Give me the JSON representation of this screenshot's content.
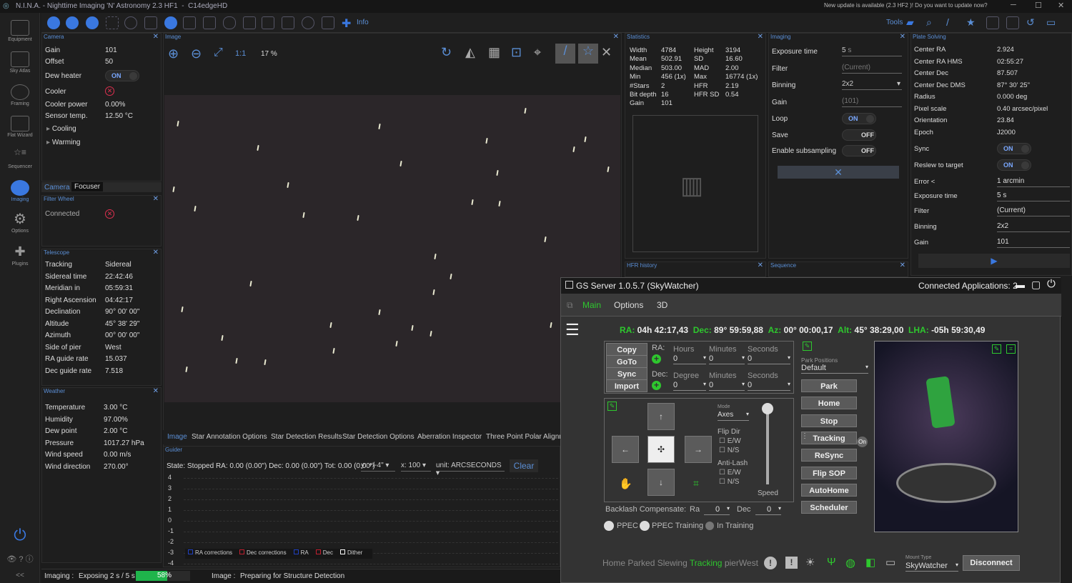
{
  "app": {
    "title": "N.I.N.A. - Nighttime Imaging 'N' Astronomy 2.3 HF1",
    "profile": "C14edgeHD",
    "update": "New update is available (2.3 HF2 )! Do you want to update now?"
  },
  "sidebar": [
    {
      "label": "Equipment"
    },
    {
      "label": "Sky Atlas"
    },
    {
      "label": "Framing"
    },
    {
      "label": "Flat Wizard"
    },
    {
      "label": "Sequencer"
    },
    {
      "label": "Imaging"
    },
    {
      "label": "Options"
    },
    {
      "label": "Plugins"
    }
  ],
  "toolbar": {
    "info": "Info",
    "tools": "Tools"
  },
  "camera": {
    "title": "Camera",
    "rows": [
      [
        "Gain",
        "101"
      ],
      [
        "Offset",
        "50"
      ],
      [
        "Dew heater",
        "ON"
      ],
      [
        "Cooler",
        ""
      ],
      [
        "Cooler power",
        "0.00%"
      ],
      [
        "Sensor temp.",
        "12.50 °C"
      ]
    ],
    "cooling": "Cooling",
    "warming": "Warming"
  },
  "tabs_cf": {
    "camera": "Camera",
    "focuser": "Focuser"
  },
  "filterwheel": {
    "title": "Filter Wheel",
    "connected": "Connected"
  },
  "telescope": {
    "title": "Telescope",
    "rows": [
      [
        "Tracking",
        "Sidereal"
      ],
      [
        "Sidereal time",
        "22:42:46"
      ],
      [
        "Meridian in",
        "05:59:31"
      ],
      [
        "Right Ascension",
        "04:42:17"
      ],
      [
        "Declination",
        "90° 00' 00\""
      ],
      [
        "Altitude",
        "45° 38' 29\""
      ],
      [
        "Azimuth",
        "00° 00' 00\""
      ],
      [
        "Side of pier",
        "West"
      ],
      [
        "RA guide rate",
        "15.037"
      ],
      [
        "Dec guide rate",
        "7.518"
      ]
    ]
  },
  "weather": {
    "title": "Weather",
    "rows": [
      [
        "Temperature",
        "3.00 °C"
      ],
      [
        "Humidity",
        "97.00%"
      ],
      [
        "Dew point",
        "2.00 °C"
      ],
      [
        "Pressure",
        "1017.27 hPa"
      ],
      [
        "Wind speed",
        "0.00 m/s"
      ],
      [
        "Wind direction",
        "270.00°"
      ]
    ]
  },
  "image": {
    "title": "Image",
    "zoom": "17 %",
    "ratio": "1:1"
  },
  "imagetabs": [
    "Image",
    "Star Annotation Options",
    "Star Detection Results",
    "Star Detection Options",
    "Aberration Inspector",
    "Three Point Polar Alignm"
  ],
  "guider": {
    "title": "Guider",
    "state": "State: Stopped  RA: 0.00 (0.00\")  Dec: 0.00 (0.00\")  Tot: 0.00 (0.00\")",
    "y": "y: +/-4\"",
    "x": "x: 100",
    "unit": "unit: ARCSECONDS",
    "clear": "Clear",
    "yticks": [
      "4",
      "3",
      "2",
      "1",
      "0",
      "-1",
      "-2",
      "-3",
      "-4"
    ],
    "legend": [
      "RA corrections",
      "Dec corrections",
      "RA",
      "Dec",
      "Dither"
    ]
  },
  "status": {
    "imaging_label": "Imaging :",
    "imaging": "Exposing 2 s / 5 s",
    "progress": "58%",
    "progress_val": 0.58,
    "image_label": "Image :",
    "image": "Preparing for Structure Detection"
  },
  "statistics": {
    "title": "Statistics",
    "left": [
      [
        "Width",
        "4784"
      ],
      [
        "Mean",
        "502.91"
      ],
      [
        "Median",
        "503.00"
      ],
      [
        "Min",
        "456 (1x)"
      ],
      [
        "#Stars",
        "2"
      ],
      [
        "Bit depth",
        "16"
      ],
      [
        "Gain",
        "101"
      ]
    ],
    "right": [
      [
        "Height",
        "3194"
      ],
      [
        "SD",
        "16.60"
      ],
      [
        "MAD",
        "2.00"
      ],
      [
        "Max",
        "16774 (1x)"
      ],
      [
        "HFR",
        "2.19"
      ],
      [
        "HFR SD",
        "0.54"
      ]
    ]
  },
  "imaging": {
    "title": "Imaging",
    "rows": [
      [
        "Exposure time",
        "5",
        "s"
      ],
      [
        "Filter",
        "(Current)",
        ""
      ],
      [
        "Binning",
        "2x2",
        ""
      ],
      [
        "Gain",
        "(101)",
        ""
      ],
      [
        "Loop",
        "ON",
        ""
      ],
      [
        "Save",
        "OFF",
        ""
      ],
      [
        "Enable subsampling",
        "OFF",
        ""
      ]
    ]
  },
  "platesolve": {
    "title": "Plate Solving",
    "rows": [
      [
        "Center RA",
        "2.924"
      ],
      [
        "Center RA HMS",
        "02:55:27"
      ],
      [
        "Center Dec",
        "87.507"
      ],
      [
        "Center Dec DMS",
        "87° 30' 25\""
      ],
      [
        "Radius",
        "0.000 deg"
      ],
      [
        "Pixel scale",
        "0.40 arcsec/pixel"
      ],
      [
        "Orientation",
        "23.84"
      ],
      [
        "Epoch",
        "J2000"
      ]
    ],
    "rows2": [
      [
        "Sync",
        "ON"
      ],
      [
        "Reslew to target",
        "ON"
      ],
      [
        "Error <",
        "1  arcmin"
      ],
      [
        "Exposure time",
        "5  s"
      ],
      [
        "Filter",
        "(Current)"
      ],
      [
        "Binning",
        "2x2"
      ],
      [
        "Gain",
        "101"
      ]
    ]
  },
  "hfr": {
    "title": "HFR history"
  },
  "sequence": {
    "title": "Sequence"
  },
  "gs": {
    "title": "GS Server 1.0.5.7 (SkyWatcher)",
    "connected": "Connected Applications: 2",
    "tabs": [
      "Main",
      "Options",
      "3D"
    ],
    "coords": [
      [
        "RA:",
        "04h 42:17,43"
      ],
      [
        "Dec:",
        "89° 59:59,88"
      ],
      [
        "Az:",
        "00° 00:00,17"
      ],
      [
        "Alt:",
        "45° 38:29,00"
      ],
      [
        "LHA:",
        "-05h 59:30,49"
      ]
    ],
    "btns": [
      "Copy",
      "GoTo",
      "Sync",
      "Import"
    ],
    "ra": "RA:",
    "dec": "Dec:",
    "hours": "Hours",
    "degree": "Degree",
    "minutes": "Minutes",
    "seconds": "Seconds",
    "zero": "0",
    "park_label": "Park Positions",
    "park_default": "Default",
    "right_btns": [
      "Park",
      "Home",
      "Stop",
      "Tracking",
      "ReSync",
      "Flip SOP",
      "AutoHome",
      "Scheduler"
    ],
    "on": "On",
    "mode_label": "Mode",
    "mode": "Axes",
    "flip": "Flip Dir",
    "ew": "E/W",
    "ns": "N/S",
    "antilash": "Anti-Lash",
    "speed": "Speed",
    "backlash": "Backlash Compensate:",
    "ra_lbl": "Ra",
    "dec_lbl": "Dec",
    "ppec": "PPEC",
    "ppec_train": "PPEC Training",
    "in_train": "In Training",
    "status": [
      "Home",
      "Parked",
      "Slewing",
      "Tracking",
      "pierWest"
    ],
    "mount_label": "Mount Type",
    "mount": "SkyWatcher",
    "disconnect": "Disconnect"
  },
  "colors": {
    "accent": "#5b8fd6",
    "green": "#2ec82e",
    "red": "#e03050"
  }
}
